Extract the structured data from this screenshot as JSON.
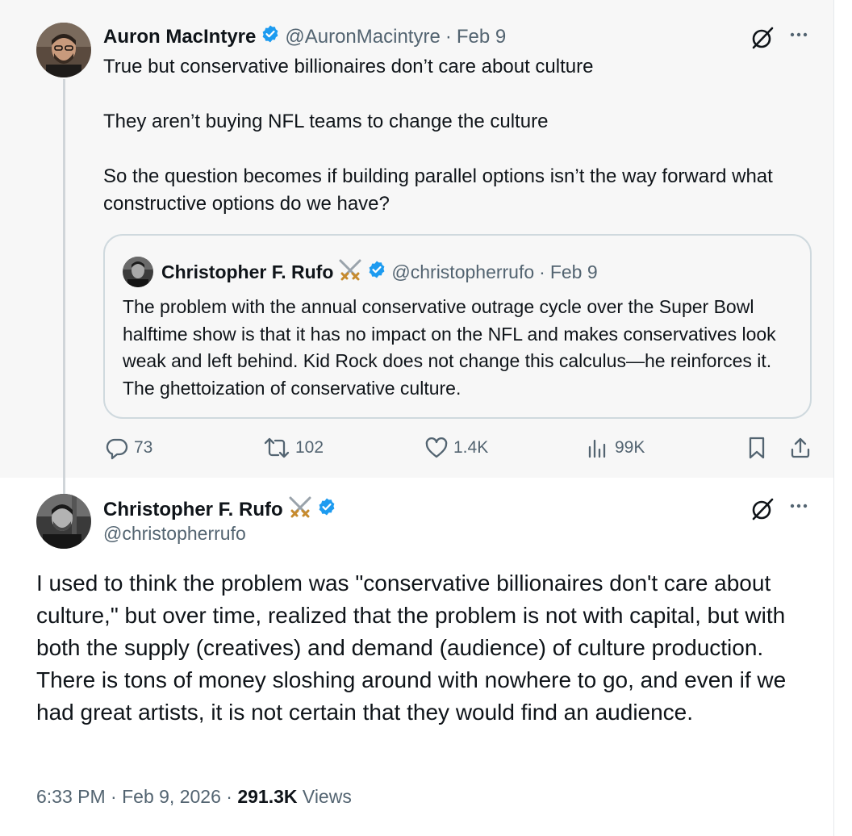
{
  "parent_tweet": {
    "author_name": "Auron MacIntyre",
    "handle": "@AuronMacintyre",
    "separator": "·",
    "date": "Feb 9",
    "paragraphs": [
      "True but conservative billionaires don’t care about culture",
      "They aren’t buying NFL teams to change the culture",
      "So the question becomes if building parallel options isn’t the way forward what constructive options do we have?"
    ],
    "quoted": {
      "author_name": "Christopher F. Rufo",
      "handle": "@christopherrufo",
      "separator": "·",
      "date": "Feb 9",
      "text": "The problem with the annual conservative outrage cycle over the Super Bowl halftime show is that it has no impact on the NFL and makes conservatives look weak and left behind. Kid Rock does not change this calculus—he reinforces it. The ghettoization of conservative culture."
    },
    "actions": {
      "replies": "73",
      "reposts": "102",
      "likes": "1.4K",
      "views": "99K"
    }
  },
  "main_tweet": {
    "author_name": "Christopher F. Rufo",
    "handle": "@christopherrufo",
    "text": "I used to think the problem was \"conservative billionaires don't care about culture,\" but over time, realized that the problem is not with capital, but with both the supply (creatives) and demand (audience) of culture production. There is tons of money sloshing around with nowhere to go, and even if we had great artists, it is not certain that they would find an audience.",
    "time": "6:33 PM",
    "date": "Feb 9, 2026",
    "separator": "·",
    "views_count": "291.3K",
    "views_label": "Views"
  },
  "colors": {
    "verified_blue": "#1d9bf0",
    "muted_text": "#536471",
    "highlight_bg": "#f7f7f7"
  },
  "icons": [
    "verified-badge-icon",
    "crossed-swords-icon",
    "grok-icon",
    "more-icon",
    "reply-icon",
    "repost-icon",
    "like-icon",
    "views-icon",
    "bookmark-icon",
    "share-icon"
  ]
}
